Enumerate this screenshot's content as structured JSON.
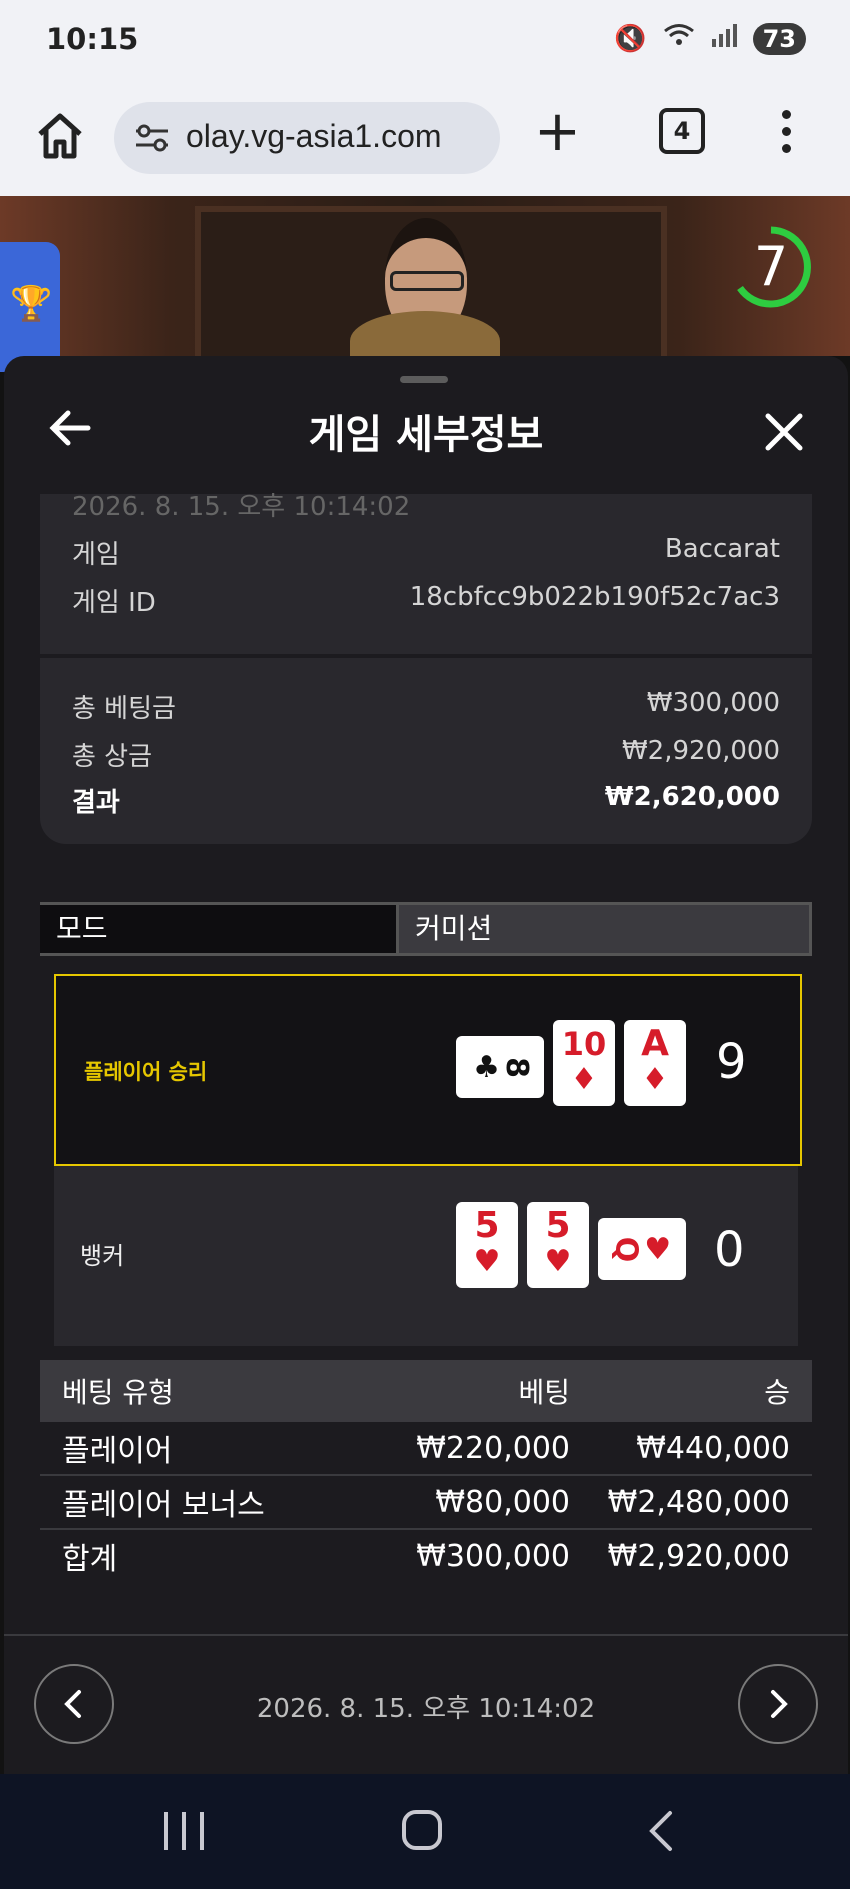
{
  "status_bar": {
    "time": "10:15",
    "battery": "73",
    "icons": [
      "mute-icon",
      "wifi-icon",
      "signal-icon"
    ]
  },
  "browser": {
    "url": "olay.vg-asia1.com",
    "tab_count": "4"
  },
  "video": {
    "countdown": "7",
    "countdown_color": "#2ecc40"
  },
  "sheet": {
    "title": "게임 세부정보",
    "timestamp_top": "2026. 8. 15. 오후 10:14:02",
    "info": [
      {
        "label": "게임",
        "value": "Baccarat"
      },
      {
        "label": "게임 ID",
        "value": "18cbfcc9b022b190f52c7ac3"
      }
    ],
    "totals": [
      {
        "label": "총 베팅금",
        "value": "₩300,000"
      },
      {
        "label": "총 상금",
        "value": "₩2,920,000"
      },
      {
        "label": "결과",
        "value": "₩2,620,000"
      }
    ],
    "mode_label": "모드",
    "mode_value": "커미션",
    "player": {
      "label": "플레이어 승리",
      "score": "9",
      "cards": [
        {
          "rank": "8",
          "suit": "♣",
          "orientation": "sideways"
        },
        {
          "rank": "10",
          "suit": "♦",
          "orientation": "upright"
        },
        {
          "rank": "A",
          "suit": "♦",
          "orientation": "upright"
        }
      ]
    },
    "banker": {
      "label": "뱅커",
      "score": "0",
      "cards": [
        {
          "rank": "5",
          "suit": "♥",
          "orientation": "upright"
        },
        {
          "rank": "5",
          "suit": "♥",
          "orientation": "upright"
        },
        {
          "rank": "Q",
          "suit": "♥",
          "orientation": "sideways"
        }
      ]
    },
    "bets": {
      "headers": [
        "베팅 유형",
        "베팅",
        "승"
      ],
      "rows": [
        [
          "플레이어",
          "₩220,000",
          "₩440,000"
        ],
        [
          "플레이어 보너스",
          "₩80,000",
          "₩2,480,000"
        ],
        [
          "합계",
          "₩300,000",
          "₩2,920,000"
        ]
      ]
    },
    "timestamp_bottom": "2026. 8. 15. 오후 10:14:02"
  },
  "colors": {
    "win_border": "#e6c700",
    "sheet_bg": "#1c1b1f",
    "card_bg": "#29282d"
  }
}
